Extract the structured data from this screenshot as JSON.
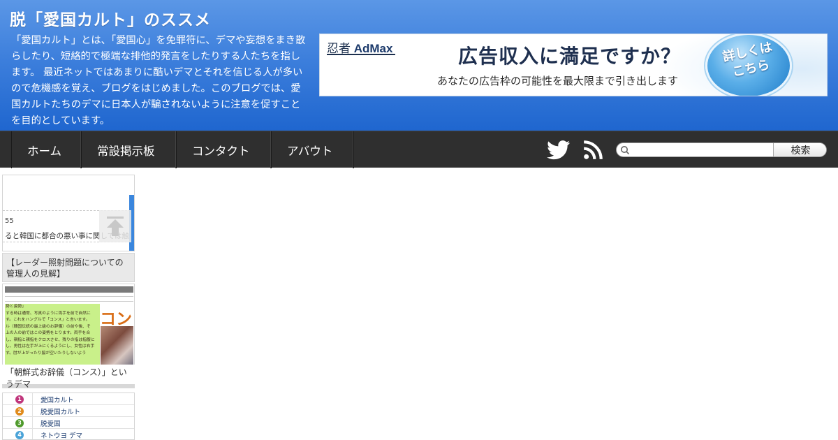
{
  "site": {
    "title": "脱「愛国カルト」のススメ",
    "description": "「愛国カルト」とは、「愛国心」を免罪符に、デマや妄想をまき散らしたり、短絡的で極端な排他的発言をしたりする人たちを指します。 最近ネットではあまりに酷いデマとそれを信じる人が多いので危機感を覚え、ブログをはじめました。このブログでは、愛国カルトたちのデマに日本人が騙されないように注意を促すことを目的としています。"
  },
  "ad": {
    "logo_prefix": "忍者",
    "logo_brand": "AdMax",
    "headline": "広告収入に満足ですか？",
    "subline": "あなたの広告枠の可能性を最大限まで引き出します",
    "cta": "詳しくは こちら"
  },
  "nav": {
    "items": [
      {
        "label": "ホーム"
      },
      {
        "label": "常設掲示板"
      },
      {
        "label": "コンタクト"
      },
      {
        "label": "アバウト"
      }
    ]
  },
  "search": {
    "placeholder": "",
    "value": "",
    "button_label": "検索"
  },
  "widgets": {
    "card1": {
      "number": "55",
      "snippet": "ると韓国に都合の悪い事に関しては触",
      "caption": "【レーダー照射問題についての管理人の見解】"
    },
    "card2": {
      "doc_lines": [
        "勢と姿勢」",
        "する時は通常、写真のように両手を前で自然に",
        "す。これをハングルで「コンス」と言います。",
        "ル（韓国伝統の最上級のお辞儀）の前や後、そ",
        "上の人の前ではこの姿勢をとります。両手を合",
        "し、親指と親指をクロスさせ、残りの指は指腹に",
        "し、男性は左手が上にくるようにし、女性は右手",
        "す。肘が上がったり脇が空いたりしないよう"
      ],
      "kanji": "コン",
      "caption": "「朝鮮式お辞儀（コンス）」というデマ"
    },
    "ranking": [
      {
        "rank": "1",
        "label": "愛国カルト",
        "color": "#c0367c"
      },
      {
        "rank": "2",
        "label": "脱愛国カルト",
        "color": "#e08b1c"
      },
      {
        "rank": "3",
        "label": "脱愛国",
        "color": "#4f9a2c"
      },
      {
        "rank": "4",
        "label": "ネトウヨ デマ",
        "color": "#4aa3d8"
      }
    ]
  },
  "colors": {
    "header_top": "#5b97e6",
    "header_bottom": "#1f66cf",
    "navbar": "#2f2f2f"
  }
}
